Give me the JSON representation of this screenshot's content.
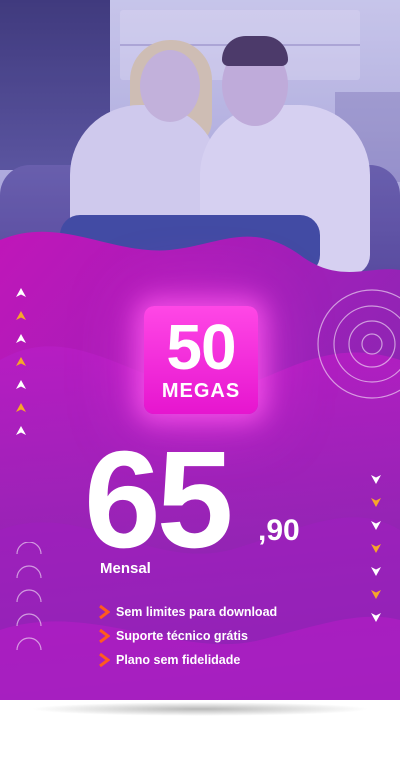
{
  "plan": {
    "speed_value": "50",
    "speed_unit": "MEGAS",
    "price_integer": "65",
    "price_decimal": ",90",
    "billing_period": "Mensal"
  },
  "features": [
    "Sem limites para download",
    "Suporte técnico grátis",
    "Plano sem fidelidade"
  ],
  "colors": {
    "background_purple": "#7b2aa8",
    "badge_magenta": "#ff47e6",
    "arrow_white": "#ffffff",
    "arrow_orange": "#f6a62a",
    "chevron_orange": "#ff5a1f"
  },
  "icons": {
    "left_column": [
      "arrow-up-icon",
      "arrow-up-icon",
      "arrow-up-icon",
      "arrow-up-icon",
      "arrow-up-icon",
      "arrow-up-icon",
      "arrow-up-icon"
    ],
    "right_column": [
      "arrow-down-icon",
      "arrow-down-icon",
      "arrow-down-icon",
      "arrow-down-icon",
      "arrow-down-icon",
      "arrow-down-icon",
      "arrow-down-icon"
    ],
    "feature_bullet": "chevron-right-icon"
  }
}
